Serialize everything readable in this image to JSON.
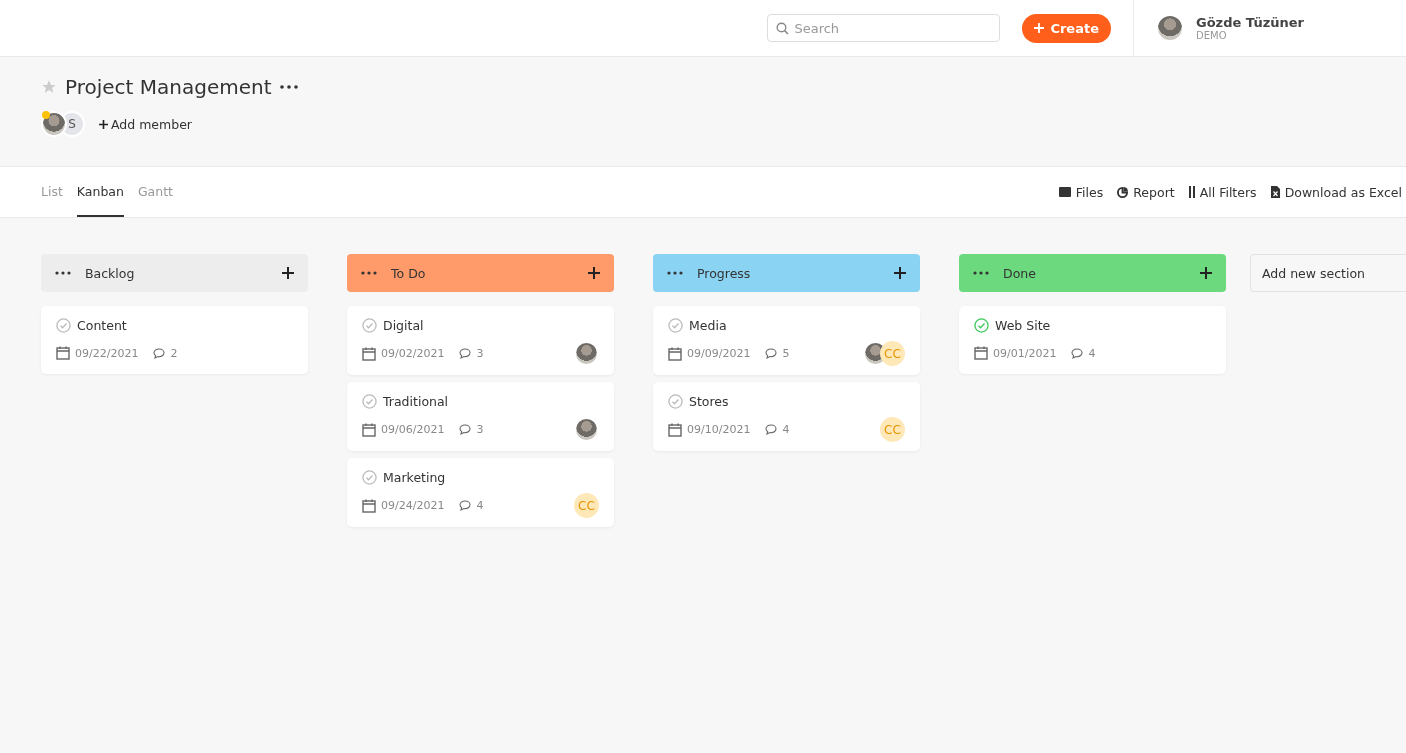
{
  "topbar": {
    "search": {
      "placeholder": "Search"
    },
    "create_label": "Create",
    "user": {
      "name": "Gözde Tüzüner",
      "role": "DEMO"
    }
  },
  "project": {
    "title": "Project Management",
    "starred": false,
    "members": [
      {
        "kind": "photo",
        "online": true
      },
      {
        "kind": "initial",
        "text": "S"
      }
    ],
    "add_member": "Add member"
  },
  "tabs": [
    {
      "label": "List",
      "selected": false
    },
    {
      "label": "Kanban",
      "selected": true
    },
    {
      "label": "Gantt",
      "selected": false
    }
  ],
  "actions": [
    {
      "kind": "files",
      "label": "Files"
    },
    {
      "kind": "report",
      "label": "Report"
    },
    {
      "kind": "filters",
      "label": "All Filters"
    },
    {
      "kind": "excel",
      "label": "Download as Excel"
    }
  ],
  "columns": [
    {
      "title": "Backlog",
      "color": "#ededed",
      "tasks": [
        {
          "title": "Content",
          "done": false,
          "date": "09/22/2021",
          "comments": "2"
        }
      ]
    },
    {
      "title": "To Do",
      "color": "#ff9b6b",
      "tasks": [
        {
          "title": "Digital",
          "done": false,
          "date": "09/02/2021",
          "comments": "3",
          "assignees": [
            {
              "kind": "photo"
            }
          ]
        },
        {
          "title": "Traditional",
          "done": false,
          "date": "09/06/2021",
          "comments": "3",
          "assignees": [
            {
              "kind": "photo"
            }
          ]
        },
        {
          "title": "Marketing",
          "done": false,
          "date": "09/24/2021",
          "comments": "4",
          "assignees": [
            {
              "kind": "initials",
              "text": "CC"
            }
          ]
        }
      ]
    },
    {
      "title": "Progress",
      "color": "#8bd3f3",
      "tasks": [
        {
          "title": "Media",
          "done": false,
          "date": "09/09/2021",
          "comments": "5",
          "assignees": [
            {
              "kind": "photo"
            },
            {
              "kind": "initials",
              "text": "CC"
            }
          ]
        },
        {
          "title": "Stores",
          "done": false,
          "date": "09/10/2021",
          "comments": "4",
          "assignees": [
            {
              "kind": "initials",
              "text": "CC"
            }
          ]
        }
      ]
    },
    {
      "title": "Done",
      "color": "#6cd97e",
      "tasks": [
        {
          "title": "Web Site",
          "done": true,
          "date": "09/01/2021",
          "comments": "4"
        }
      ]
    }
  ],
  "add_section": "Add new section"
}
